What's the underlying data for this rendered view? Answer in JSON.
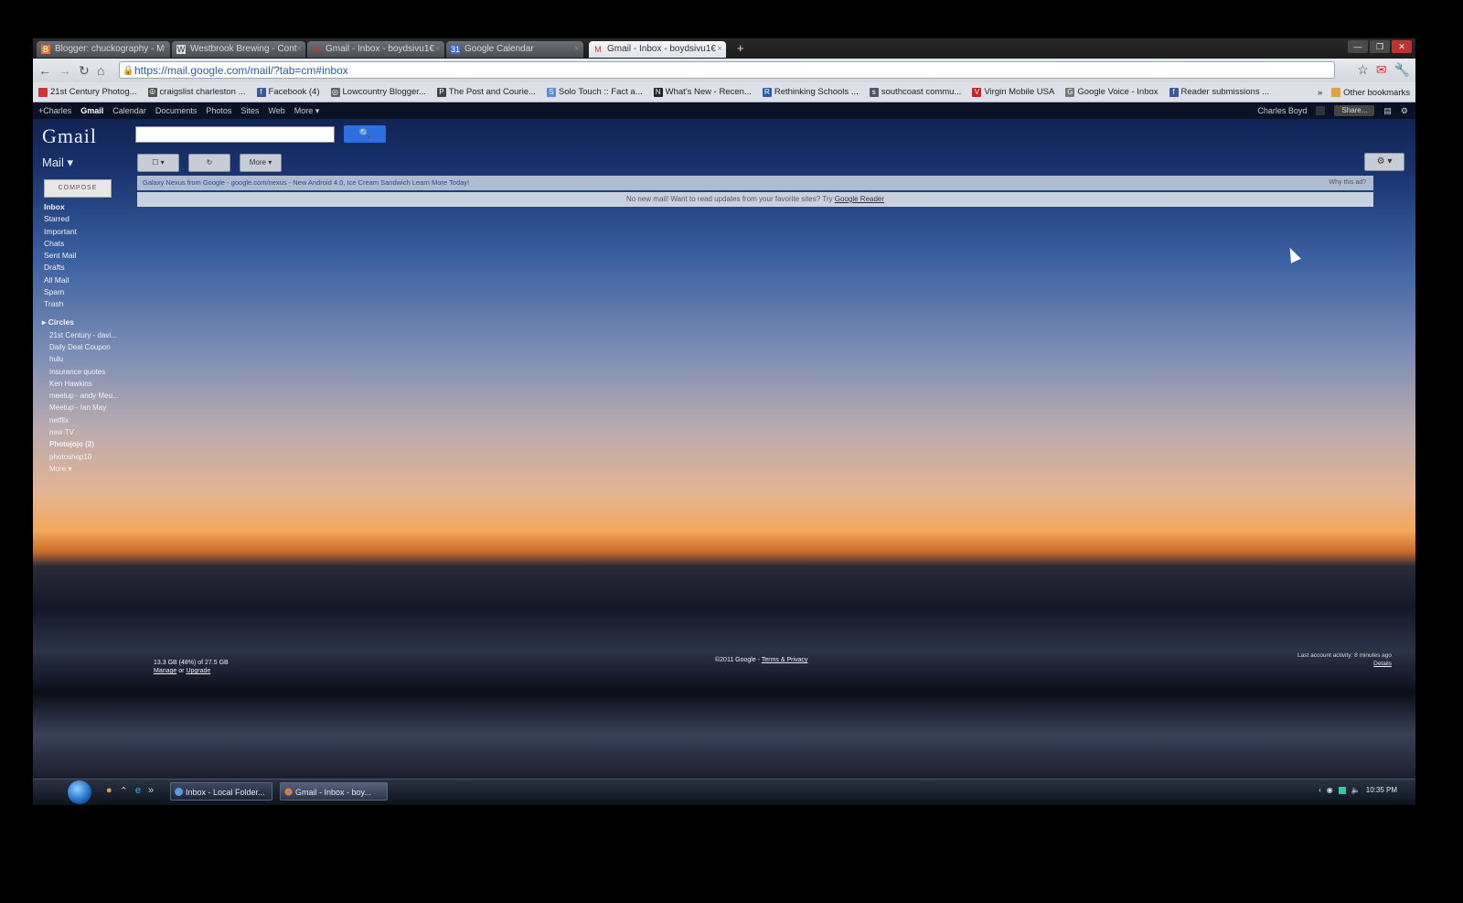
{
  "browser": {
    "tabs": [
      {
        "label": "Blogger: chuckography - M",
        "icon": "blogger-icon"
      },
      {
        "label": "Westbrook Brewing - Cont",
        "icon": "page-icon"
      },
      {
        "label": "Gmail - Inbox - boydsivu1€",
        "icon": "gmail-icon"
      },
      {
        "label": "Google Calendar",
        "icon": "calendar-icon"
      },
      {
        "label": "Gmail - Inbox - boydsivu1€",
        "icon": "gmail-icon",
        "active": true
      }
    ],
    "url": "https://mail.google.com/mail/?tab=cm#inbox",
    "bookmarks": [
      "21st Century Photog...",
      "craigslist charleston ...",
      "Facebook (4)",
      "Lowcountry Blogger...",
      "The Post and Courie...",
      "Solo Touch :: Fact a...",
      "What's New - Recen...",
      "Rethinking Schools ...",
      "southcoast commu...",
      "Virgin Mobile USA",
      "Google Voice - Inbox",
      "Reader submissions ..."
    ],
    "bookmarks_more": "»",
    "other_bookmarks": "Other bookmarks"
  },
  "gbar": {
    "items": [
      "+Charles",
      "Gmail",
      "Calendar",
      "Documents",
      "Photos",
      "Sites",
      "Web",
      "More ▾"
    ],
    "user": "Charles Boyd",
    "share": "Share..."
  },
  "gmail": {
    "logo": "Gmail",
    "mail_label": "Mail ▾",
    "more_btn": "More ▾",
    "compose": "COMPOSE",
    "ad_text": "Galaxy Nexus from Google - google.com/nexus - New Android 4.0, Ice Cream Sandwich Learn More Today!",
    "ad_why": "Why this ad?",
    "notice_text": "No new mail! Want to read updates from your favorite sites? Try",
    "notice_link": "Google Reader",
    "nav": [
      "Inbox",
      "Starred",
      "Important",
      "Chats",
      "Sent Mail",
      "Drafts",
      "All Mail",
      "Spam",
      "Trash"
    ],
    "circles_label": "Circles",
    "labels": [
      "21st Century - davi...",
      "Daily Deal Coupon",
      "hulu",
      "Insurance quotes",
      "Ken Hawkins",
      "meetup - andy Meu...",
      "Meetup - Ian May",
      "netflix",
      "new TV",
      "Photojojo (2)",
      "photoshop10",
      "More ▾"
    ],
    "storage": "13.3 GB (48%) of 27.5 GB",
    "manage": "Manage",
    "or": "or",
    "upgrade": "Upgrade",
    "footer_copy": "©2011 Google -",
    "footer_link": "Terms & Privacy",
    "activity": "Last account activity: 8 minutes ago",
    "details": "Details"
  },
  "taskbar": {
    "tasks": [
      "Inbox - Local Folder...",
      "Gmail - Inbox - boy..."
    ],
    "clock": "10:35 PM"
  }
}
